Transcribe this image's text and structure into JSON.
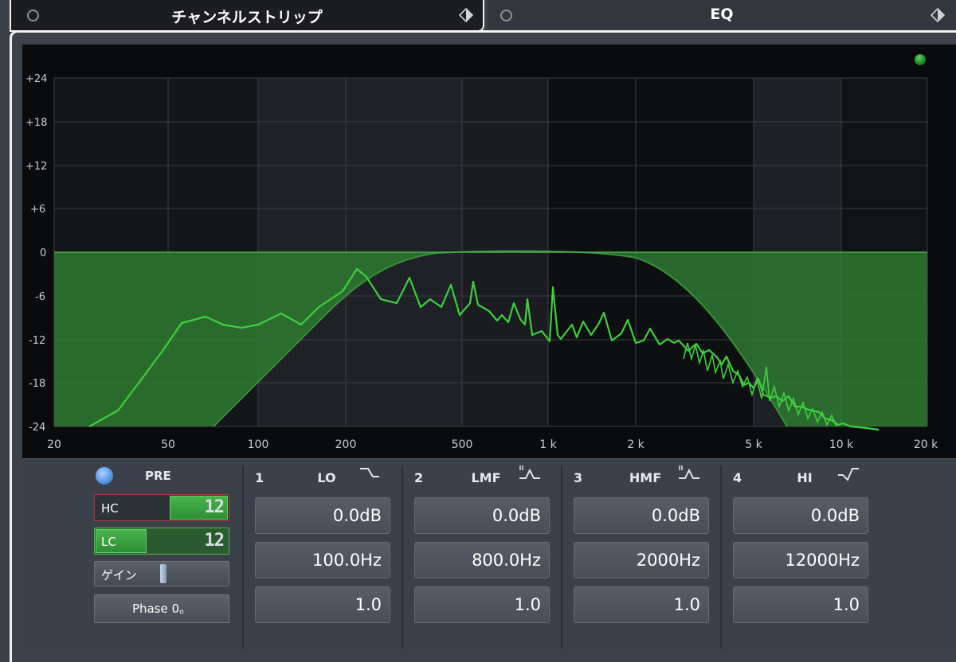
{
  "tabs": {
    "left_title": "チャンネルストリップ",
    "right_title": "EQ"
  },
  "graph": {
    "y_labels": [
      "+24",
      "+18",
      "+12",
      "+6",
      "0",
      "-6",
      "-12",
      "-18",
      "-24"
    ],
    "x_labels": [
      "20",
      "50",
      "100",
      "200",
      "500",
      "1 k",
      "2 k",
      "5 k",
      "10 k",
      "20 k"
    ]
  },
  "pre": {
    "label": "PRE",
    "hc_label": "HC",
    "hc_value": "12",
    "lc_label": "LC",
    "lc_value": "12",
    "gain_label": "ゲイン",
    "phase_label": "Phase 0。"
  },
  "bands": [
    {
      "num": "1",
      "name": "LO",
      "icon": "low-shelf-icon",
      "gain": "0.0dB",
      "freq": "100.0Hz",
      "q": "1.0"
    },
    {
      "num": "2",
      "name": "LMF",
      "icon": "peak-filter-icon",
      "gain": "0.0dB",
      "freq": "800.0Hz",
      "q": "1.0"
    },
    {
      "num": "3",
      "name": "HMF",
      "icon": "peak-filter-icon",
      "gain": "0.0dB",
      "freq": "2000Hz",
      "q": "1.0"
    },
    {
      "num": "4",
      "name": "HI",
      "icon": "high-shelf-icon",
      "gain": "0.0dB",
      "freq": "12000Hz",
      "q": "1.0"
    }
  ],
  "colors": {
    "accent_green": "#3ecf3e",
    "fill_green": "#2e7d32",
    "pre_led": "#4e8fe0",
    "hc_border": "#b3373b"
  }
}
